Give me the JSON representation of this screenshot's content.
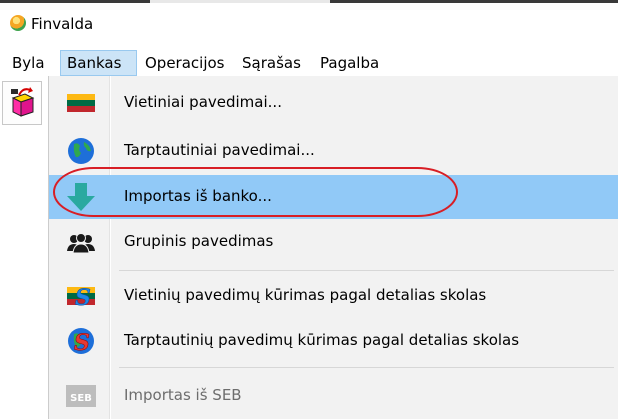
{
  "window": {
    "title": "Finvalda"
  },
  "menubar": {
    "items": [
      {
        "label": "Byla",
        "active": false
      },
      {
        "label": "Bankas",
        "active": true
      },
      {
        "label": "Operacijos",
        "active": false
      },
      {
        "label": "Sąrašas",
        "active": false
      },
      {
        "label": "Pagalba",
        "active": false
      }
    ]
  },
  "dropdown": {
    "items": [
      {
        "label": "Vietiniai pavedimai...",
        "icon": "lithuania-flag-icon"
      },
      {
        "label": "Tarptautiniai pavedimai...",
        "icon": "globe-icon"
      },
      {
        "label": "Importas iš banko...",
        "icon": "download-arrow-icon",
        "highlighted": true
      },
      {
        "label": "Grupinis pavedimas",
        "icon": "group-people-icon"
      },
      {
        "label": "Vietinių pavedimų kūrimas pagal detalias skolas",
        "icon": "flag-s-icon"
      },
      {
        "label": "Tarptautinių pavedimų kūrimas pagal detalias skolas",
        "icon": "globe-s-icon"
      },
      {
        "label": "Importas iš SEB",
        "icon": "seb-logo-icon",
        "disabled": true
      }
    ],
    "seb_icon_text": "SEB"
  },
  "colors": {
    "highlight": "#91c9f7",
    "menu_active": "#cce4f7",
    "annotation": "#d81e25",
    "menu_background": "#f2f2f2"
  }
}
